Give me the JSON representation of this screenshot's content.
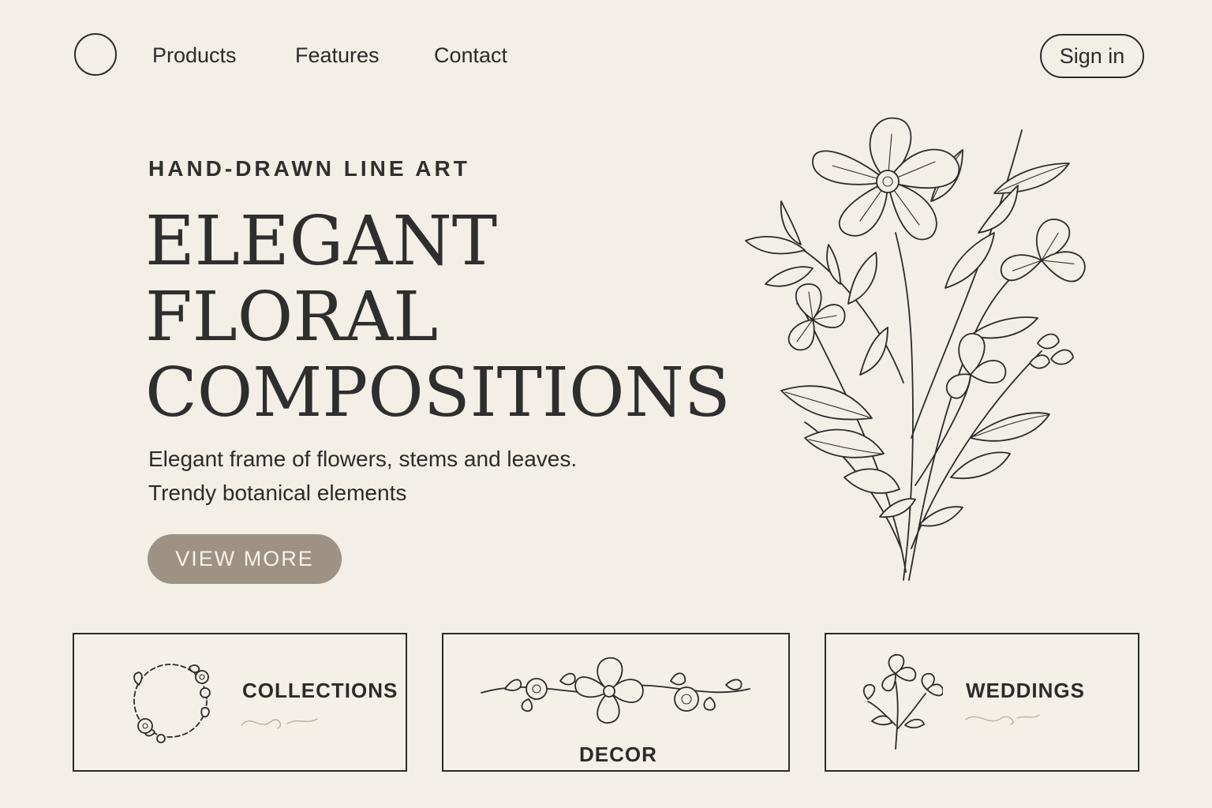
{
  "nav": {
    "logo_icon": "circle-logo",
    "links": [
      {
        "label": "Products"
      },
      {
        "label": "Features"
      },
      {
        "label": "Contact"
      }
    ],
    "signin_label": "Sign in"
  },
  "hero": {
    "eyebrow": "HAND-DRAWN LINE ART",
    "headline_lines": [
      "ELEGANT",
      "FLORAL",
      "COMPOSITIONS"
    ],
    "subtext_lines": [
      "Elegant frame of flowers, stems and leaves.",
      "Trendy botanical elements"
    ],
    "cta_label": "VIEW MORE",
    "illustration": "floral-bouquet-line-art"
  },
  "cards": [
    {
      "label": "COLLECTIONS",
      "icon": "floral-wreath-icon"
    },
    {
      "label": "DECOR",
      "icon": "floral-garland-icon"
    },
    {
      "label": "WEDDINGS",
      "icon": "floral-sprig-icon"
    }
  ],
  "colors": {
    "background": "#f3efe6",
    "ink": "#2b2b2b",
    "cta_fill": "#9d9283",
    "cta_text": "#f6f2ea"
  }
}
